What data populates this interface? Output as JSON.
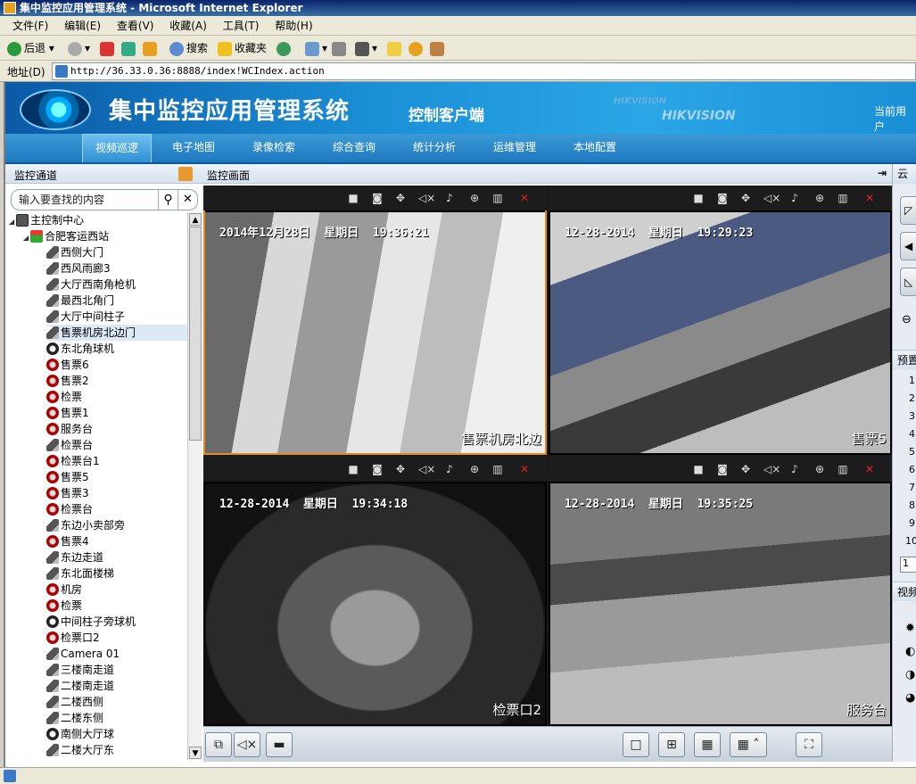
{
  "window": {
    "title": "集中监控应用管理系统 - Microsoft Internet Explorer"
  },
  "menu": [
    "文件(F)",
    "编辑(E)",
    "查看(V)",
    "收藏(A)",
    "工具(T)",
    "帮助(H)"
  ],
  "toolbar": {
    "back": "后退",
    "search": "搜索",
    "favorites": "收藏夹"
  },
  "address": {
    "label": "地址(D)",
    "url": "http://36.33.0.36:8888/index!WCIndex.action"
  },
  "app": {
    "title": "集中监控应用管理系统",
    "subtitle": "控制客户端",
    "brand_small": "HIKVISION",
    "brand_large": "HIKVISION",
    "current_user": "当前用户"
  },
  "nav": [
    "视频巡逻",
    "电子地图",
    "录像检索",
    "综合查询",
    "统计分析",
    "运维管理",
    "本地配置"
  ],
  "left_panel": {
    "title": "监控通道",
    "search_placeholder": "输入要查找的内容",
    "tree": [
      {
        "label": "主控制中心",
        "icon": "pc",
        "level": 0
      },
      {
        "label": "合肥客运西站",
        "icon": "home",
        "level": 1
      },
      {
        "label": "西侧大门",
        "icon": "cam",
        "level": 2
      },
      {
        "label": "西风雨廊3",
        "icon": "cam",
        "level": 2
      },
      {
        "label": "大厅西南角枪机",
        "icon": "cam",
        "level": 2
      },
      {
        "label": "最西北角门",
        "icon": "cam",
        "level": 2
      },
      {
        "label": "大厅中间柱子",
        "icon": "cam",
        "level": 2
      },
      {
        "label": "售票机房北边门",
        "icon": "cam",
        "level": 2,
        "selected": true
      },
      {
        "label": "东北角球机",
        "icon": "dome",
        "level": 2
      },
      {
        "label": "售票6",
        "icon": "red",
        "level": 2
      },
      {
        "label": "售票2",
        "icon": "red",
        "level": 2
      },
      {
        "label": "检票",
        "icon": "red",
        "level": 2
      },
      {
        "label": "售票1",
        "icon": "red",
        "level": 2
      },
      {
        "label": "服务台",
        "icon": "red",
        "level": 2
      },
      {
        "label": "检票台",
        "icon": "cam",
        "level": 2
      },
      {
        "label": "检票台1",
        "icon": "red",
        "level": 2
      },
      {
        "label": "售票5",
        "icon": "red",
        "level": 2
      },
      {
        "label": "售票3",
        "icon": "red",
        "level": 2
      },
      {
        "label": "检票台",
        "icon": "red",
        "level": 2
      },
      {
        "label": "东边小卖部旁",
        "icon": "cam",
        "level": 2
      },
      {
        "label": "售票4",
        "icon": "red",
        "level": 2
      },
      {
        "label": "东边走道",
        "icon": "cam",
        "level": 2
      },
      {
        "label": "东北面楼梯",
        "icon": "cam",
        "level": 2
      },
      {
        "label": "机房",
        "icon": "red",
        "level": 2
      },
      {
        "label": "检票",
        "icon": "red",
        "level": 2
      },
      {
        "label": "中间柱子旁球机",
        "icon": "dome",
        "level": 2
      },
      {
        "label": "检票口2",
        "icon": "red",
        "level": 2
      },
      {
        "label": "Camera 01",
        "icon": "cam",
        "level": 2
      },
      {
        "label": "三楼南走道",
        "icon": "cam",
        "level": 2
      },
      {
        "label": "二楼南走道",
        "icon": "cam",
        "level": 2
      },
      {
        "label": "二楼西侧",
        "icon": "cam",
        "level": 2
      },
      {
        "label": "二楼东侧",
        "icon": "cam",
        "level": 2
      },
      {
        "label": "南侧大厅球",
        "icon": "dome",
        "level": 2
      },
      {
        "label": "二楼大厅东",
        "icon": "cam",
        "level": 2
      }
    ]
  },
  "video_area": {
    "title": "监控画面",
    "panes": [
      {
        "timestamp": "2014年12月28日  星期日  19:36:21",
        "name": "售票机房北边",
        "selected": true
      },
      {
        "timestamp": "12-28-2014  星期日  19:29:23",
        "name": "售票5"
      },
      {
        "timestamp": "12-28-2014  星期日  19:34:18",
        "name": "检票口2"
      },
      {
        "timestamp": "12-28-2014  星期日  19:35:25",
        "name": "服务台"
      }
    ]
  },
  "right_panel": {
    "title": "云镜",
    "preset_title": "预置",
    "preset_numbers": [
      "1",
      "2",
      "3",
      "4",
      "5",
      "6",
      "7",
      "8",
      "9",
      "10"
    ],
    "preset_input": "1",
    "video_title": "视频"
  }
}
